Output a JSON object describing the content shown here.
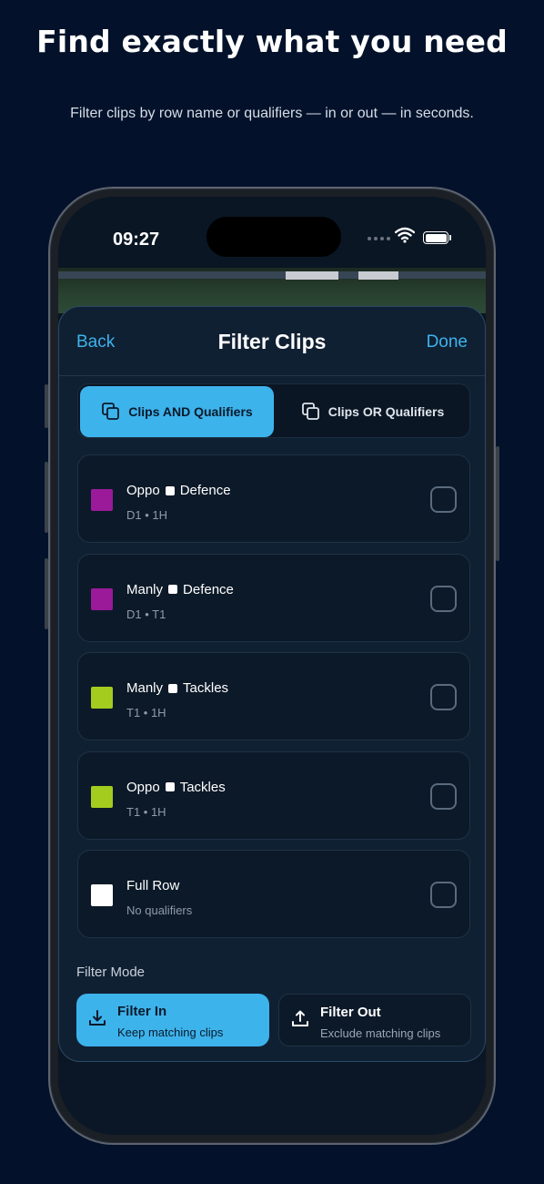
{
  "marketing": {
    "headline": "Find exactly what you need",
    "subhead": "Filter clips by row name or qualifiers — in or out — in seconds."
  },
  "status_bar": {
    "time": "09:27"
  },
  "nav": {
    "back_label": "Back",
    "title": "Filter Clips",
    "done_label": "Done"
  },
  "match_toggle": {
    "options": [
      {
        "label": "Clips AND Qualifiers",
        "selected": true
      },
      {
        "label": "Clips OR Qualifiers",
        "selected": false
      }
    ]
  },
  "rows": [
    {
      "team": "Oppo",
      "category": "Defence",
      "qualifiers": "D1  •  1H",
      "color": "#9a1a9a",
      "checked": false
    },
    {
      "team": "Manly",
      "category": "Defence",
      "qualifiers": "D1  •  T1",
      "color": "#9a1a9a",
      "checked": false
    },
    {
      "team": "Manly",
      "category": "Tackles",
      "qualifiers": "T1  •  1H",
      "color": "#a4cc1e",
      "checked": false
    },
    {
      "team": "Oppo",
      "category": "Tackles",
      "qualifiers": "T1  •  1H",
      "color": "#a4cc1e",
      "checked": false
    },
    {
      "team": "Full Row",
      "category": "",
      "qualifiers": "No qualifiers",
      "color": "#ffffff",
      "checked": false
    }
  ],
  "filter_mode": {
    "label": "Filter Mode",
    "in": {
      "title": "Filter In",
      "subtitle": "Keep matching clips",
      "selected": true
    },
    "out": {
      "title": "Filter Out",
      "subtitle": "Exclude matching clips",
      "selected": false
    }
  },
  "colors": {
    "accent": "#3db3ec",
    "background": "#03122a",
    "sheet": "#102033"
  }
}
